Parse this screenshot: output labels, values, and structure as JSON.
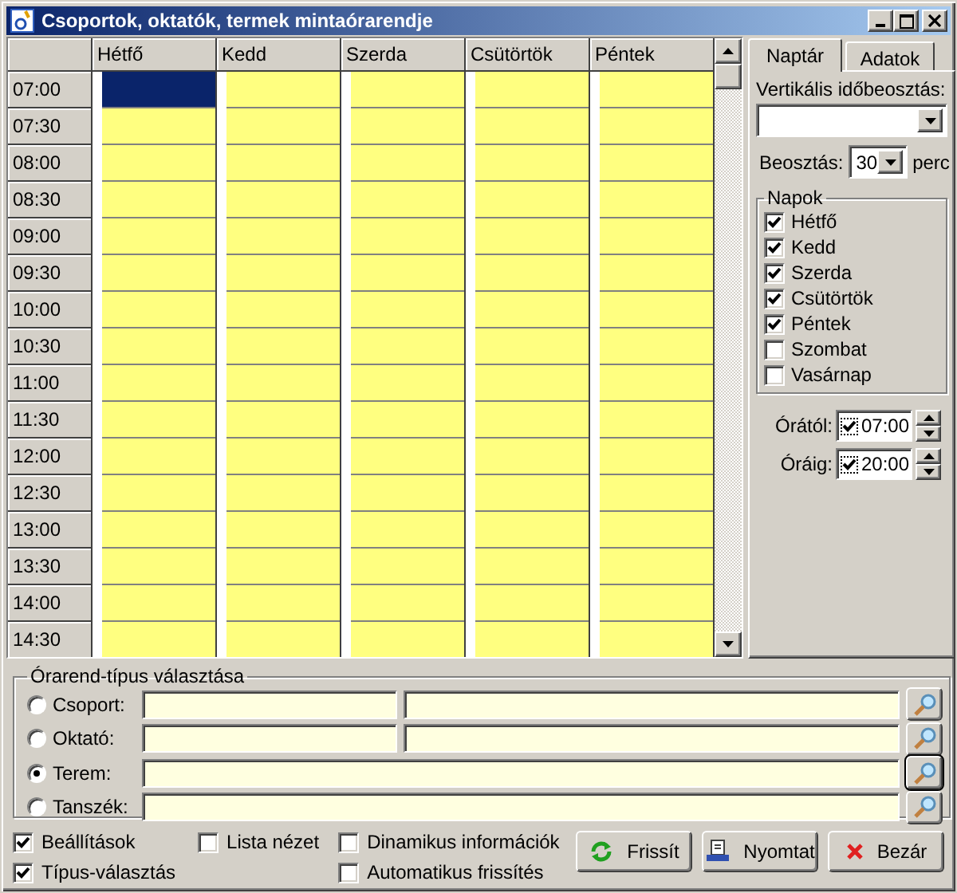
{
  "window": {
    "title": "Csoportok, oktatók, termek mintaórarendje"
  },
  "schedule": {
    "days": [
      "Hétfő",
      "Kedd",
      "Szerda",
      "Csütörtök",
      "Péntek"
    ],
    "rows": [
      {
        "time": "07:00",
        "cells": [
          {
            "selected": true
          },
          {
            "selected": false
          },
          {
            "selected": false
          },
          {
            "selected": false
          },
          {
            "selected": false
          }
        ]
      },
      {
        "time": "07:30",
        "cells": [
          {
            "selected": false
          },
          {
            "selected": false
          },
          {
            "selected": false
          },
          {
            "selected": false
          },
          {
            "selected": false
          }
        ]
      },
      {
        "time": "08:00",
        "cells": [
          {
            "selected": false
          },
          {
            "selected": false
          },
          {
            "selected": false
          },
          {
            "selected": false
          },
          {
            "selected": false
          }
        ]
      },
      {
        "time": "08:30",
        "cells": [
          {
            "selected": false
          },
          {
            "selected": false
          },
          {
            "selected": false
          },
          {
            "selected": false
          },
          {
            "selected": false
          }
        ]
      },
      {
        "time": "09:00",
        "cells": [
          {
            "selected": false
          },
          {
            "selected": false
          },
          {
            "selected": false
          },
          {
            "selected": false
          },
          {
            "selected": false
          }
        ]
      },
      {
        "time": "09:30",
        "cells": [
          {
            "selected": false
          },
          {
            "selected": false
          },
          {
            "selected": false
          },
          {
            "selected": false
          },
          {
            "selected": false
          }
        ]
      },
      {
        "time": "10:00",
        "cells": [
          {
            "selected": false
          },
          {
            "selected": false
          },
          {
            "selected": false
          },
          {
            "selected": false
          },
          {
            "selected": false
          }
        ]
      },
      {
        "time": "10:30",
        "cells": [
          {
            "selected": false
          },
          {
            "selected": false
          },
          {
            "selected": false
          },
          {
            "selected": false
          },
          {
            "selected": false
          }
        ]
      },
      {
        "time": "11:00",
        "cells": [
          {
            "selected": false
          },
          {
            "selected": false
          },
          {
            "selected": false
          },
          {
            "selected": false
          },
          {
            "selected": false
          }
        ]
      },
      {
        "time": "11:30",
        "cells": [
          {
            "selected": false
          },
          {
            "selected": false
          },
          {
            "selected": false
          },
          {
            "selected": false
          },
          {
            "selected": false
          }
        ]
      },
      {
        "time": "12:00",
        "cells": [
          {
            "selected": false
          },
          {
            "selected": false
          },
          {
            "selected": false
          },
          {
            "selected": false
          },
          {
            "selected": false
          }
        ]
      },
      {
        "time": "12:30",
        "cells": [
          {
            "selected": false
          },
          {
            "selected": false
          },
          {
            "selected": false
          },
          {
            "selected": false
          },
          {
            "selected": false
          }
        ]
      },
      {
        "time": "13:00",
        "cells": [
          {
            "selected": false
          },
          {
            "selected": false
          },
          {
            "selected": false
          },
          {
            "selected": false
          },
          {
            "selected": false
          }
        ]
      },
      {
        "time": "13:30",
        "cells": [
          {
            "selected": false
          },
          {
            "selected": false
          },
          {
            "selected": false
          },
          {
            "selected": false
          },
          {
            "selected": false
          }
        ]
      },
      {
        "time": "14:00",
        "cells": [
          {
            "selected": false
          },
          {
            "selected": false
          },
          {
            "selected": false
          },
          {
            "selected": false
          },
          {
            "selected": false
          }
        ]
      },
      {
        "time": "14:30",
        "cells": [
          {
            "selected": false
          },
          {
            "selected": false
          },
          {
            "selected": false
          },
          {
            "selected": false
          },
          {
            "selected": false
          }
        ]
      }
    ]
  },
  "side_panel": {
    "tabs": [
      {
        "label": "Naptár",
        "selected": true
      },
      {
        "label": "Adatok",
        "selected": false
      }
    ],
    "vertical_label": "Vertikális időbeosztás:",
    "interval": {
      "label": "Beosztás:",
      "value": "30",
      "unit": "perc"
    },
    "days_group": {
      "title": "Napok",
      "items": [
        {
          "label": "Hétfő",
          "checked": true
        },
        {
          "label": "Kedd",
          "checked": true
        },
        {
          "label": "Szerda",
          "checked": true
        },
        {
          "label": "Csütörtök",
          "checked": true
        },
        {
          "label": "Péntek",
          "checked": true
        },
        {
          "label": "Szombat",
          "checked": false
        },
        {
          "label": "Vasárnap",
          "checked": false
        }
      ]
    },
    "time_range": [
      {
        "label": "Órától:",
        "checked": true,
        "value": "07:00"
      },
      {
        "label": "Óráig:",
        "checked": true,
        "value": "20:00"
      }
    ]
  },
  "type_group": {
    "title": "Órarend-típus választása",
    "options": [
      {
        "label": "Csoport:",
        "selected": false,
        "kind": "split"
      },
      {
        "label": "Oktató:",
        "selected": false,
        "kind": "split"
      },
      {
        "label": "Terem:",
        "selected": true,
        "kind": "single"
      },
      {
        "label": "Tanszék:",
        "selected": false,
        "kind": "single"
      }
    ]
  },
  "option_columns": [
    [
      {
        "label": "Beállítások",
        "checked": true
      },
      {
        "label": "Típus-választás",
        "checked": true
      }
    ],
    [
      {
        "label": "Lista nézet",
        "checked": false
      }
    ],
    [
      {
        "label": "Dinamikus információk",
        "checked": false
      },
      {
        "label": "Automatikus frissítés",
        "checked": false
      }
    ]
  ],
  "buttons": [
    {
      "label": "Frissít",
      "kind": "refresh"
    },
    {
      "label": "Nyomtat",
      "kind": "print"
    },
    {
      "label": "Bezár",
      "kind": "close"
    }
  ]
}
